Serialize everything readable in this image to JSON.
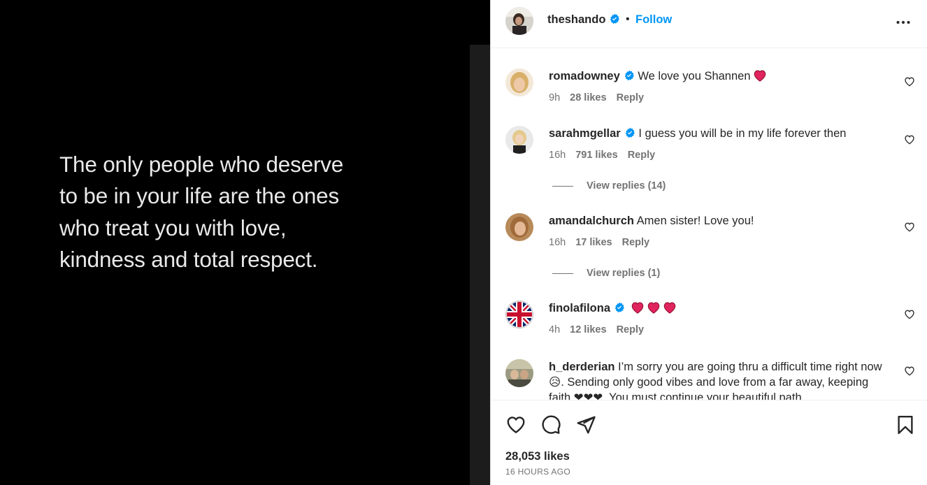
{
  "post": {
    "quote_text": "The only people who deserve to be in your life are the ones who treat you with love, kindness and total respect."
  },
  "header": {
    "username": "theshando",
    "separator": "•",
    "follow_label": "Follow"
  },
  "comments": [
    {
      "username": "romadowney",
      "verified": true,
      "text": "We love you Shannen",
      "time": "9h",
      "likes": "28 likes",
      "reply": "Reply"
    },
    {
      "username": "sarahmgellar",
      "verified": true,
      "text": "I guess you will be in my life forever then",
      "time": "16h",
      "likes": "791 likes",
      "reply": "Reply",
      "view_replies": "View replies (14)"
    },
    {
      "username": "amandalchurch",
      "verified": false,
      "text": "Amen sister! Love you!",
      "time": "16h",
      "likes": "17 likes",
      "reply": "Reply",
      "view_replies": "View replies (1)"
    },
    {
      "username": "finolafilona",
      "verified": true,
      "text": "",
      "time": "4h",
      "likes": "12 likes",
      "reply": "Reply"
    },
    {
      "username": "h_derderian",
      "verified": false,
      "text": "I’m sorry you are going thru a difficult time right now 😥. Sending only good vibes and love from a far away, keeping faith ❤❤❤. You must continue your beautiful path"
    }
  ],
  "footer": {
    "likes_count": "28,053 likes",
    "timestamp": "16 HOURS AGO"
  },
  "colors": {
    "accent": "#0095f6",
    "verified": "#0095f6",
    "heart_emoji": "#e0245e",
    "muted_text": "#737373"
  },
  "icons": [
    "verified-badge-icon",
    "more-options-icon",
    "heart-icon",
    "comment-icon",
    "share-icon",
    "bookmark-icon"
  ]
}
